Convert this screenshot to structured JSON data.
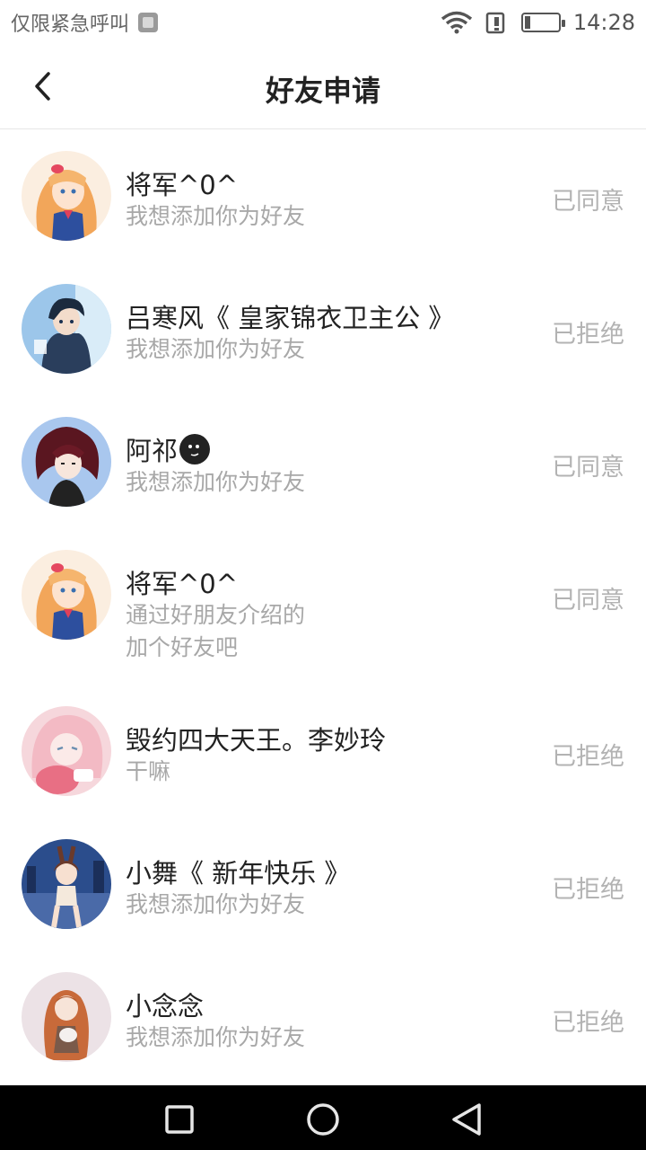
{
  "status_bar": {
    "carrier_text": "仅限紧急呼叫",
    "time": "14:28"
  },
  "header": {
    "title": "好友申请"
  },
  "requests": [
    {
      "name": "将军^0^",
      "message": "我想添加你为好友",
      "status": "已同意",
      "avatar_color": "#f4c38a"
    },
    {
      "name": "吕寒风《 皇家锦衣卫主公 》",
      "message": "我想添加你为好友",
      "status": "已拒绝",
      "avatar_color": "#3a5a8a"
    },
    {
      "name": "阿祁",
      "message": "我想添加你为好友",
      "status": "已同意",
      "avatar_color": "#5b1f2a"
    },
    {
      "name": "将军^0^",
      "message": "通过好朋友介绍的",
      "message_line2": "加个好友吧",
      "status": "已同意",
      "avatar_color": "#f4c38a"
    },
    {
      "name": "毁约四大天王。李妙玲",
      "message": "干嘛",
      "status": "已拒绝",
      "avatar_color": "#f0b8c0"
    },
    {
      "name": "小舞《 新年快乐 》",
      "message": "我想添加你为好友",
      "status": "已拒绝",
      "avatar_color": "#2b4d8c"
    },
    {
      "name": "小念念",
      "message": "我想添加你为好友",
      "status": "已拒绝",
      "avatar_color": "#e9dde0"
    }
  ],
  "colors": {
    "status_text": "#b3b3b3",
    "message_text": "#a8a8a8",
    "name_text": "#222222"
  },
  "icons": {
    "back": "chevron-left-icon",
    "nav_recent": "square-icon",
    "nav_home": "circle-icon",
    "nav_back": "triangle-back-icon"
  }
}
